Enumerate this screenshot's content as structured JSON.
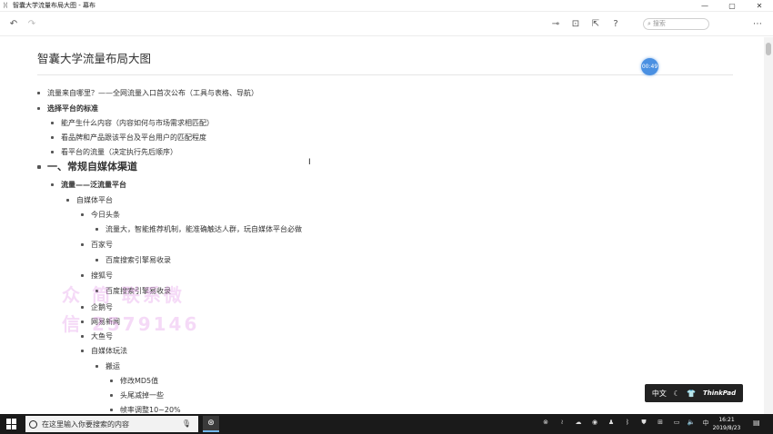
{
  "window": {
    "title": "智囊大学流量布局大图 - 幕布",
    "minimize": "—",
    "maximize": "▢",
    "close": "✕"
  },
  "toolbar": {
    "search_placeholder": "搜索"
  },
  "document": {
    "title": "智囊大学流量布局大图",
    "badge": "00:49",
    "nodes": [
      {
        "text": "流量来自哪里？——全网流量入口首次公布（工具与表格、导航）",
        "level": 0,
        "style": "normal"
      },
      {
        "text": "选择平台的标准",
        "level": 0,
        "style": "bold"
      },
      {
        "text": "能产生什么内容（内容如何与市场需求相匹配）",
        "level": 1,
        "style": "normal"
      },
      {
        "text": "看品牌和产品跟该平台及平台用户的匹配程度",
        "level": 1,
        "style": "normal"
      },
      {
        "text": "看平台的流量（决定执行先后顺序）",
        "level": 1,
        "style": "normal"
      },
      {
        "text": "一、常规自媒体渠道",
        "level": 0,
        "style": "h1"
      },
      {
        "text": "流量——泛流量平台",
        "level": 1,
        "style": "bold"
      },
      {
        "text": "自媒体平台",
        "level": 2,
        "style": "normal"
      },
      {
        "text": "今日头条",
        "level": 3,
        "style": "normal"
      },
      {
        "text": "流量大，智能推荐机制，能准确触达人群，玩自媒体平台必做",
        "level": 4,
        "style": "normal"
      },
      {
        "text": "百家号",
        "level": 3,
        "style": "normal"
      },
      {
        "text": "百度搜索引擎易收录",
        "level": 4,
        "style": "normal"
      },
      {
        "text": "搜狐号",
        "level": 3,
        "style": "normal"
      },
      {
        "text": "百度搜索引擎易收录",
        "level": 4,
        "style": "normal"
      },
      {
        "text": "企鹅号",
        "level": 3,
        "style": "normal"
      },
      {
        "text": "网易新闻",
        "level": 3,
        "style": "normal"
      },
      {
        "text": "大鱼号",
        "level": 3,
        "style": "normal"
      },
      {
        "text": "自媒体玩法",
        "level": 3,
        "style": "normal"
      },
      {
        "text": "搬运",
        "level": 4,
        "style": "normal"
      },
      {
        "text": "修改MD5值",
        "level": 5,
        "style": "normal"
      },
      {
        "text": "头尾减掉一些",
        "level": 5,
        "style": "normal"
      },
      {
        "text": "帧率调整10~20%",
        "level": 5,
        "style": "normal"
      }
    ]
  },
  "watermark": {
    "line1": "众  简  联系微",
    "line2": "信  2579146"
  },
  "ime": {
    "lang": "中文",
    "moon": "☾",
    "shirt": "👕",
    "brand": "ThinkPad"
  },
  "taskbar": {
    "search_placeholder": "在这里输入你要搜索的内容",
    "clock_time": "16:21",
    "clock_date": "2019/8/23",
    "ime_indicator": "中"
  }
}
